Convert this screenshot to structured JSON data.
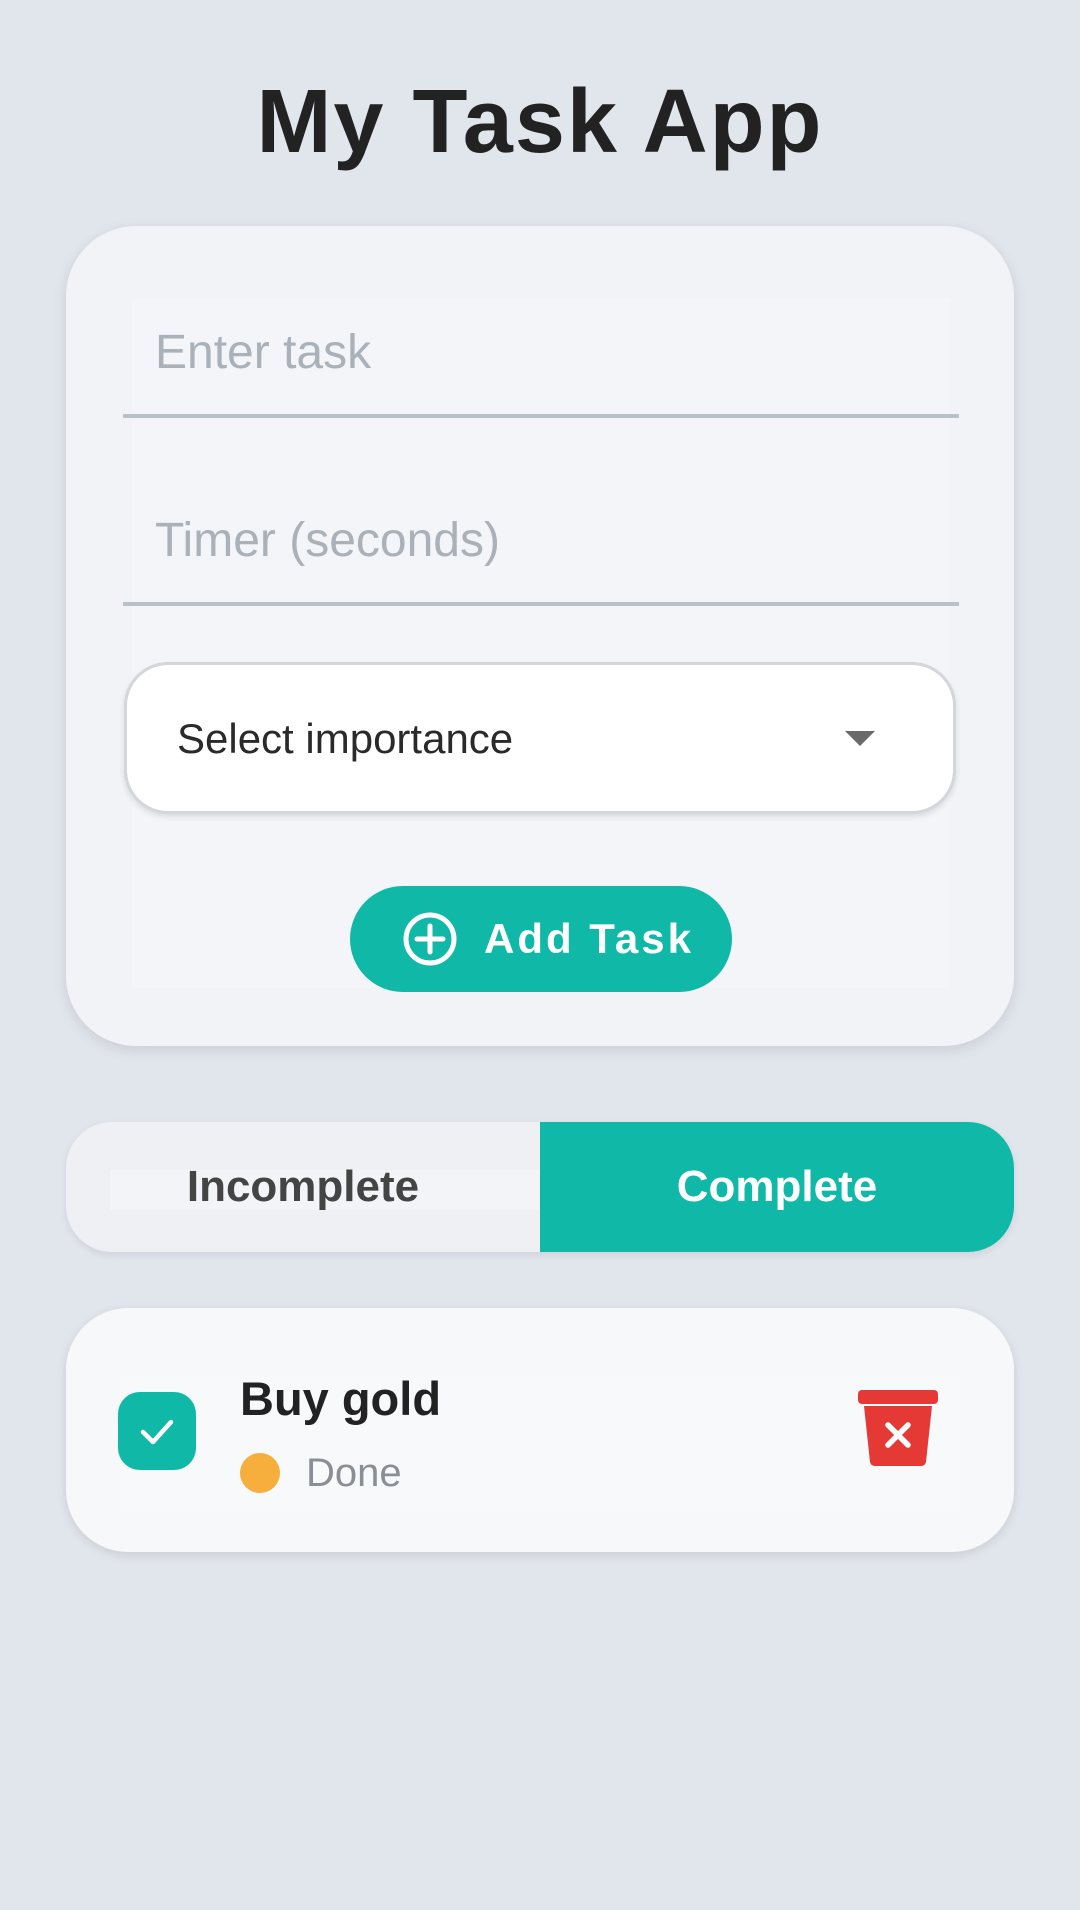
{
  "header": {
    "title": "My Task App"
  },
  "form": {
    "task_placeholder": "Enter task",
    "timer_placeholder": "Timer (seconds)",
    "importance_label": "Select importance",
    "add_button_label": "Add Task"
  },
  "tabs": {
    "items": [
      {
        "label": "Incomplete",
        "active": false
      },
      {
        "label": "Complete",
        "active": true
      }
    ]
  },
  "tasks": [
    {
      "title": "Buy gold",
      "status": "Done",
      "checked": true,
      "status_color": "#f6ae3c"
    }
  ],
  "icons": {
    "add": "plus-circle-icon",
    "dropdown": "caret-down-icon",
    "check": "check-icon",
    "delete": "trash-icon"
  },
  "colors": {
    "accent": "#10b9a7",
    "background": "#e1e5ec",
    "danger": "#e53935",
    "importance_dot": "#f6ae3c"
  }
}
